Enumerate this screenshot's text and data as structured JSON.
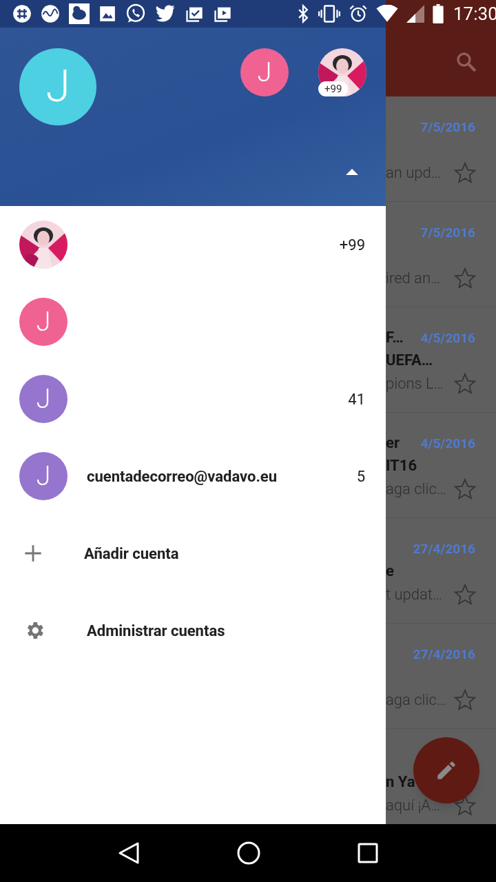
{
  "status_bar": {
    "time": "17:30"
  },
  "drawer": {
    "header": {
      "current_avatar": {
        "initial": "J",
        "color": "#4dd0e1"
      },
      "other_accounts": [
        {
          "kind": "letter",
          "initial": "J",
          "color": "#f06292"
        },
        {
          "kind": "picture",
          "badge": "+99"
        }
      ],
      "expanded": true
    },
    "accounts": [
      {
        "kind": "picture",
        "count": "+99"
      },
      {
        "kind": "letter",
        "initial": "J",
        "color": "#f06292"
      },
      {
        "kind": "letter",
        "initial": "J",
        "color": "#9575cd",
        "count": "41"
      },
      {
        "kind": "letter",
        "initial": "J",
        "color": "#9575cd",
        "email": "cuentadecorreo@vadavo.eu",
        "count": "5"
      }
    ],
    "actions": [
      {
        "kind": "add",
        "label": "Añadir cuenta"
      },
      {
        "kind": "settings",
        "label": "Administrar cuentas"
      }
    ]
  },
  "messages": [
    {
      "date": "7/5/2016",
      "snippet": "an upd…",
      "starred": false
    },
    {
      "date": "7/5/2016",
      "snippet": "ired an…",
      "starred": false
    },
    {
      "sender": "F…",
      "date": "4/5/2016",
      "subject": "UEFA…",
      "snippet": "pions L…",
      "starred": false
    },
    {
      "sender": "er",
      "date": "4/5/2016",
      "subject": "IT16",
      "snippet": "aga clic…",
      "starred": false
    },
    {
      "date": "27/4/2016",
      "subject": "e",
      "snippet": "t updat…",
      "starred": false
    },
    {
      "date": "27/4/2016",
      "snippet": "aga clic…",
      "starred": false
    },
    {
      "subject": "n Ya",
      "snippet": "aquí ¡A…",
      "starred": false
    }
  ]
}
